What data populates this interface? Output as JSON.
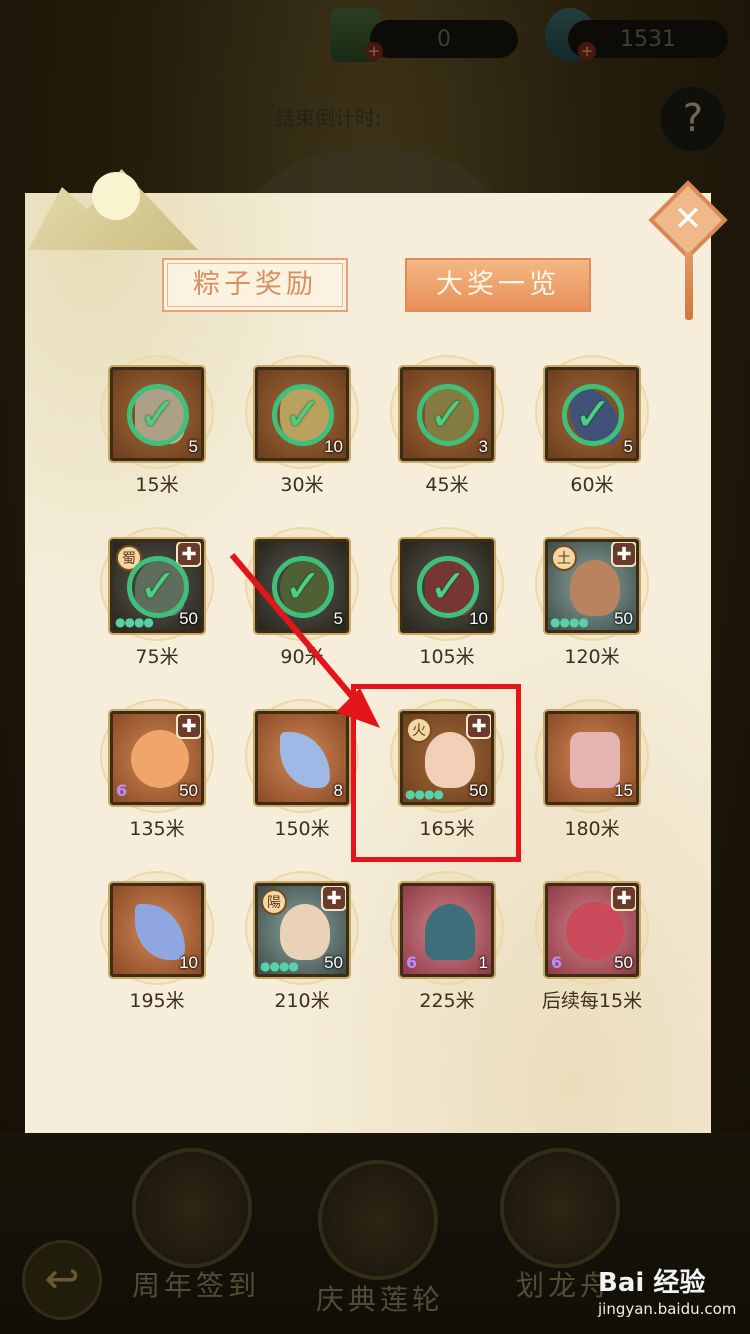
{
  "currency": {
    "first_value": "0",
    "second_value": "1531",
    "first_icon": "scroll-bundle-icon",
    "second_icon": "jade-leaf-icon"
  },
  "countdown": {
    "label": "结束倒计时:"
  },
  "help": {
    "label": "?"
  },
  "tabs": {
    "zongzi_rewards": "粽子奖励",
    "grand_prize_overview": "大奖一览"
  },
  "rewards": [
    {
      "distance": "15米",
      "count": "5",
      "claimed": true
    },
    {
      "distance": "30米",
      "count": "10",
      "claimed": true
    },
    {
      "distance": "45米",
      "count": "3",
      "claimed": true
    },
    {
      "distance": "60米",
      "count": "5",
      "claimed": true
    },
    {
      "distance": "75米",
      "count": "50",
      "claimed": true,
      "faction": "蜀"
    },
    {
      "distance": "90米",
      "count": "5",
      "claimed": true
    },
    {
      "distance": "105米",
      "count": "10",
      "claimed": true
    },
    {
      "distance": "120米",
      "count": "50",
      "claimed": false,
      "faction": "土"
    },
    {
      "distance": "135米",
      "count": "50",
      "claimed": false,
      "tier": "6"
    },
    {
      "distance": "150米",
      "count": "8",
      "claimed": false
    },
    {
      "distance": "165米",
      "count": "50",
      "claimed": false,
      "faction": "火"
    },
    {
      "distance": "180米",
      "count": "15",
      "claimed": false
    },
    {
      "distance": "195米",
      "count": "10",
      "claimed": false
    },
    {
      "distance": "210米",
      "count": "50",
      "claimed": false,
      "faction": "陽"
    },
    {
      "distance": "225米",
      "count": "1",
      "claimed": false,
      "tier": "6"
    },
    {
      "distance": "后续每15米",
      "count": "50",
      "claimed": false,
      "tier": "6"
    }
  ],
  "menu": {
    "anniversary_signin": "周年签到",
    "celebration_wheel": "庆典莲轮",
    "dragon_boat": "划龙舟",
    "back": "↩"
  },
  "watermark": {
    "brand": "Bai 经验",
    "url": "jingyan.baidu.com"
  },
  "colors": {
    "panel": "#f6eedb",
    "tab_active": "#e9905a",
    "claimed_check": "#3fc07a",
    "annotation": "#e3141a"
  }
}
